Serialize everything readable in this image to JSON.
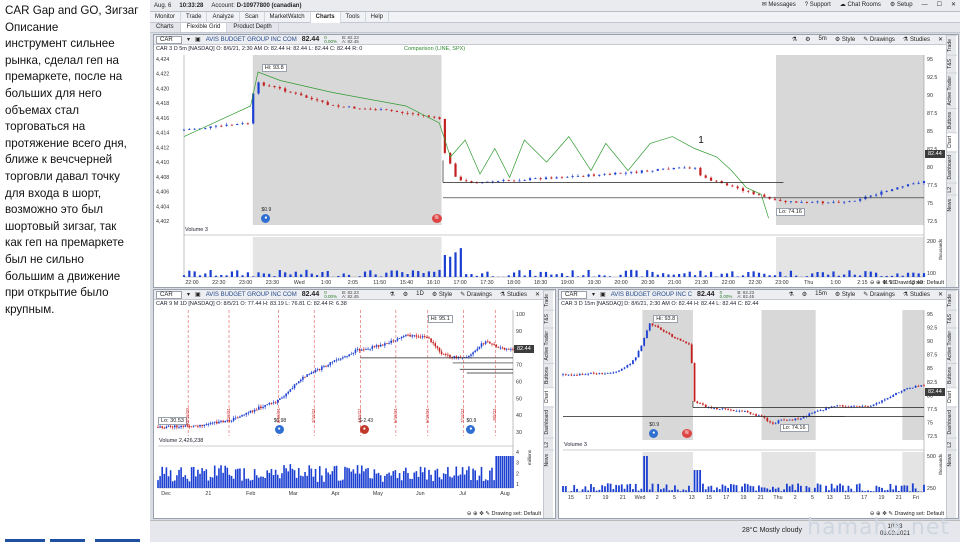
{
  "caption": {
    "title": "CAR Gap and GO, Зигзаг",
    "lines": [
      "Описание",
      "инструмент сильнее",
      "рынка,  сделал геп на",
      "премаркете, после на",
      "больших для него",
      "объемах стал",
      "торговаться на",
      "протяжение всего дня,",
      "ближе к вечсчерней",
      "торговли давал точку",
      "для входа в шорт,",
      "возможно это был",
      "шортовый зигзаг, так",
      "как геп на премаркете",
      "был не сильно",
      "большим а движение",
      "при открытие было",
      "крупным."
    ]
  },
  "topbar": {
    "date": "Aug. 6",
    "time": "10:33:28",
    "account_label": "Account:",
    "account": "D-10977800 (canadian)",
    "messages": "Messages",
    "support": "Support",
    "chat": "Chat Rooms",
    "setup": "Setup"
  },
  "menu": [
    "Monitor",
    "Trade",
    "Analyze",
    "Scan",
    "MarketWatch",
    "Charts",
    "Tools",
    "Help"
  ],
  "subtabs": [
    "Charts",
    "Flexible Grid",
    "Product Depth"
  ],
  "colors": {
    "up": "#1b3fd1",
    "down": "#c42020",
    "comparison": "#2f9a2f",
    "shade": "#d8d8d8",
    "price_tag": "#3c3c3c",
    "bg": "#ffffff"
  },
  "panels": {
    "top": {
      "symbol": "CAR",
      "company": "AVIS BUDGET GROUP INC COM",
      "price": "82.44",
      "change": "0",
      "change_pct": "0.00%",
      "bid": "B: 82.23",
      "ask": "A: 82.45",
      "timeframe": "5m",
      "style": "Style",
      "drawings": "Drawings",
      "studies": "Studies",
      "stats": "CAR 3 D 5m [NASDAQ]   O: 8/6/21, 2:30 AM   O: 82.44   H: 82.44   L: 82.44   C: 82.44   R: 0",
      "comparison": "Comparison (LINE, SPX)",
      "hi_label": "Hi: 93.8",
      "lo_label": "Lo: 74.16",
      "price_tag": "82.44",
      "earn_tag": "$0.9",
      "annotation": "1",
      "volume_label": "Volume   3",
      "vol_units": "thousands",
      "drawing_set": "Drawing set: Default",
      "left_axis": [
        "4,424",
        "4,422",
        "4,420",
        "4,418",
        "4,416",
        "4,414",
        "4,412",
        "4,410",
        "4,408",
        "4,406",
        "4,404",
        "4,402"
      ],
      "right_axis": [
        "95",
        "92.5",
        "90",
        "87.5",
        "85",
        "82.5",
        "80",
        "77.5",
        "75",
        "72.5"
      ],
      "x_labels": [
        "22:00",
        "22:30",
        "23:00",
        "23:30",
        "Wed",
        "1:00",
        "2:05",
        "11:50",
        "15:40",
        "16:10",
        "17:00",
        "17:30",
        "18:00",
        "18:30",
        "19:00",
        "19:30",
        "20:00",
        "20:30",
        "21:00",
        "21:30",
        "22:00",
        "22:30",
        "23:00",
        "Thu",
        "1:00",
        "2:15",
        "11:20",
        "13:40"
      ],
      "vol_axis": [
        "200",
        "100"
      ],
      "sidetabs": [
        "Trade",
        "T&S",
        "Active Trader",
        "Buttons",
        "Chart",
        "Dashboard",
        "L2",
        "News"
      ]
    },
    "bottom_left": {
      "symbol": "CAR",
      "company": "AVIS BUDGET GROUP INC COM",
      "price": "82.44",
      "change": "0",
      "change_pct": "0.00%",
      "bid": "B: 82.23",
      "ask": "A: 82.45",
      "timeframe": "1D",
      "style": "Style",
      "drawings": "Drawings",
      "studies": "Studies",
      "stats": "CAR 9 M 1D [NASDAQ]   O: 8/5/21   O: 77.44   H: 83.19   L: 76.81   C: 82.44   R: 6.38",
      "hi_label": "Hi: 95.1",
      "lo_label": "Lo: 30.53",
      "price_tag": "82.44",
      "earn_tags": [
        "$0.98",
        "$-2.43",
        "$0.9"
      ],
      "date_tags": [
        "12/15/20",
        "1/15/21",
        "2/15/21",
        "3/15/21",
        "4/15/21",
        "5/15/21",
        "6/15/21",
        "7/15/21",
        "8/5/21"
      ],
      "volume_label": "Volume   2,426,238",
      "vol_units": "millions",
      "drawing_set": "Drawing set: Default",
      "right_axis": [
        "100",
        "90",
        "80",
        "70",
        "60",
        "50",
        "40",
        "30"
      ],
      "x_labels": [
        "Dec",
        "21",
        "Feb",
        "Mar",
        "Apr",
        "May",
        "Jun",
        "Jul",
        "Aug"
      ],
      "vol_axis": [
        "4",
        "3",
        "2",
        "1"
      ],
      "sidetabs": [
        "Trade",
        "T&S",
        "Active Trader",
        "Buttons",
        "Chart",
        "Dashboard",
        "L2",
        "News"
      ]
    },
    "bottom_right": {
      "symbol": "CAR",
      "company": "AVIS BUDGET GROUP INC C",
      "price": "82.44",
      "change": "0",
      "change_pct": "0.00%",
      "bid": "B: 82.23",
      "ask": "A: 82.45",
      "timeframe": "15m",
      "style": "Style",
      "drawings": "Drawings",
      "studies": "Studies",
      "stats": "CAR 3 D 15m [NASDAQ]   D: 8/6/21, 2:30 AM   O: 82.44   H: 82.44   L: 82.44   C: 82.44",
      "hi_label": "Hi: 93.8",
      "lo_label": "Lo: 74.16",
      "price_tag": "82.44",
      "earn_tag": "$0.9",
      "volume_label": "Volume   3",
      "vol_units": "thousands",
      "drawing_set": "Drawing set: Default",
      "right_axis": [
        "95",
        "92.5",
        "90",
        "87.5",
        "85",
        "82.5",
        "80",
        "77.5",
        "75",
        "72.5"
      ],
      "x_labels": [
        "15",
        "17",
        "19",
        "21",
        "Wed",
        "2",
        "5",
        "13",
        "15",
        "17",
        "19",
        "21",
        "Thu",
        "2",
        "5",
        "13",
        "15",
        "17",
        "19",
        "21",
        "Fri"
      ],
      "vol_axis": [
        "500",
        "250"
      ],
      "sidetabs": [
        "Trade",
        "T&S",
        "Active Trader",
        "Buttons",
        "Chart",
        "Dashboard",
        "L2",
        "News"
      ]
    }
  },
  "taskbar": {
    "weather": "28°C   Mostly cloudy",
    "clock_time": "10:33",
    "clock_date": "06.08.2021"
  },
  "watermark": "hamaha.net"
}
